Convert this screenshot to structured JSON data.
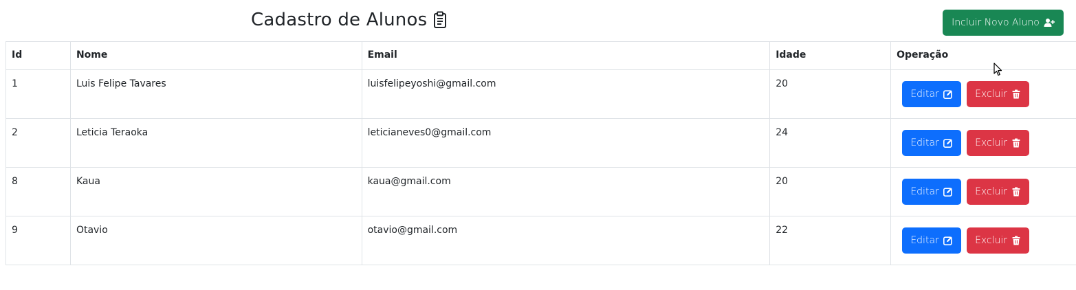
{
  "header": {
    "title": "Cadastro de Alunos",
    "title_icon": "clipboard-icon",
    "add_button_label": "Incluir Novo Aluno",
    "add_button_icon": "user-plus-icon"
  },
  "table": {
    "columns": [
      "Id",
      "Nome",
      "Email",
      "Idade",
      "Operação"
    ],
    "rows": [
      {
        "id": "1",
        "nome": "Luis Felipe Tavares",
        "email": "luisfelipeyoshi@gmail.com",
        "idade": "20"
      },
      {
        "id": "2",
        "nome": "Leticia Teraoka",
        "email": "leticianeves0@gmail.com",
        "idade": "24"
      },
      {
        "id": "8",
        "nome": "Kaua",
        "email": "kaua@gmail.com",
        "idade": "20"
      },
      {
        "id": "9",
        "nome": "Otavio",
        "email": "otavio@gmail.com",
        "idade": "22"
      }
    ],
    "edit_label": "Editar",
    "edit_icon": "edit-icon",
    "delete_label": "Excluir",
    "delete_icon": "trash-icon"
  },
  "colors": {
    "success": "#198754",
    "primary": "#0d6efd",
    "danger": "#dc3545",
    "border": "#dee2e6",
    "text": "#212529"
  }
}
